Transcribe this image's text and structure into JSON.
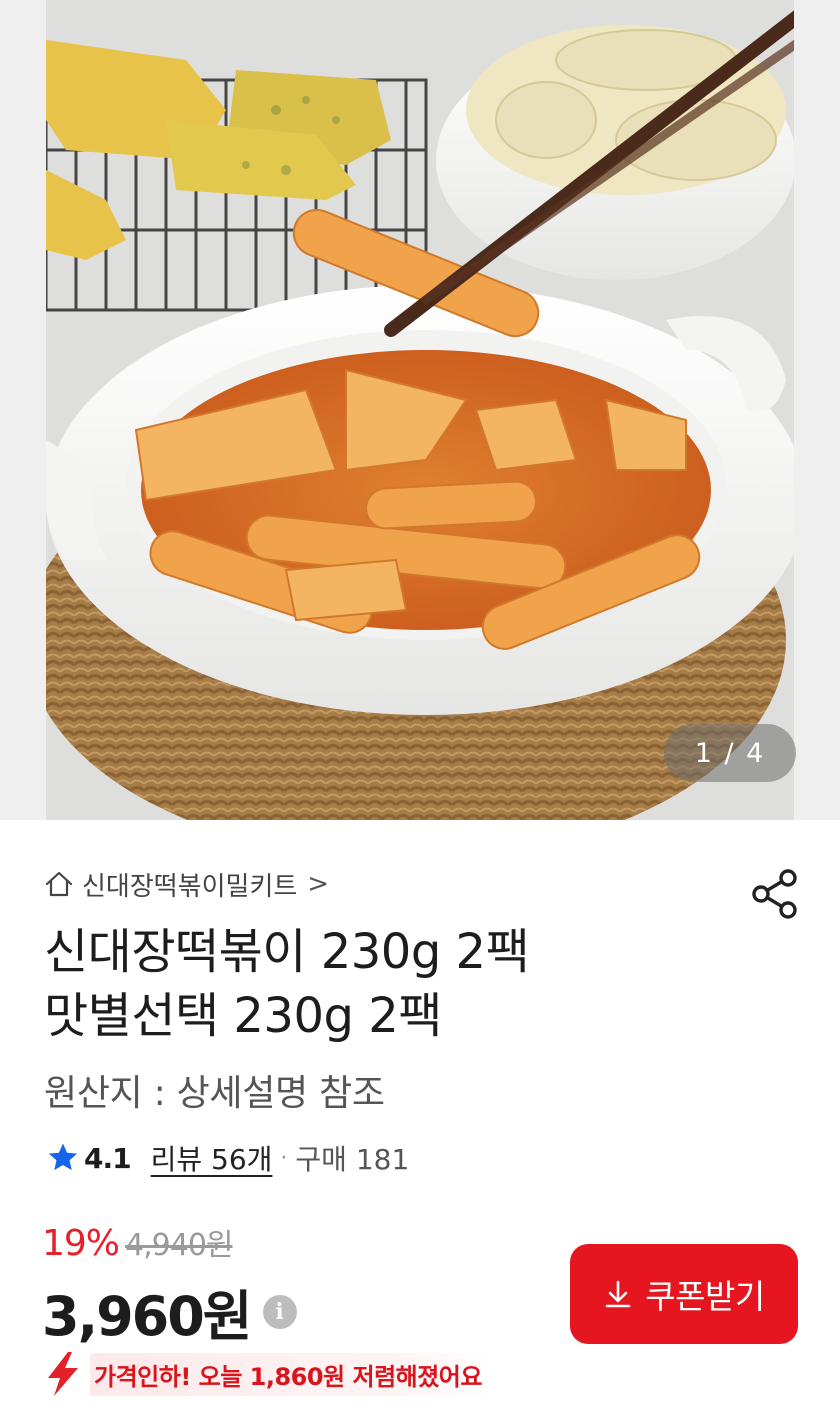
{
  "gallery": {
    "image_alt": "신대장떡볶이 product photo",
    "counter_text": "1 / 4",
    "current": 1,
    "total": 4
  },
  "breadcrumb": {
    "icon": "home-icon",
    "label": "신대장떡볶이밀키트",
    "chevron": ">"
  },
  "share": {
    "icon": "share-icon"
  },
  "product": {
    "title_line1": "신대장떡볶이 230g 2팩",
    "title_line2": "맛별선택 230g 2팩",
    "origin": "원산지 : 상세설명 참조"
  },
  "rating": {
    "icon": "star-icon",
    "score": "4.1",
    "reviews_label": "리뷰 56개",
    "separator": "·",
    "purchase_label": "구매 181",
    "star_color": "#1565e8"
  },
  "pricing": {
    "discount_rate": "19%",
    "original_price": "4,940원",
    "sale_price": "3,960원",
    "info_icon": "info-icon",
    "info_glyph": "i"
  },
  "coupon": {
    "icon": "download-icon",
    "label": "쿠폰받기",
    "color": "#e5161f"
  },
  "promo": {
    "icon": "lightning-icon",
    "text": "가격인하! 오늘 1,860원 저렴해졌어요",
    "color": "#d8141d"
  }
}
